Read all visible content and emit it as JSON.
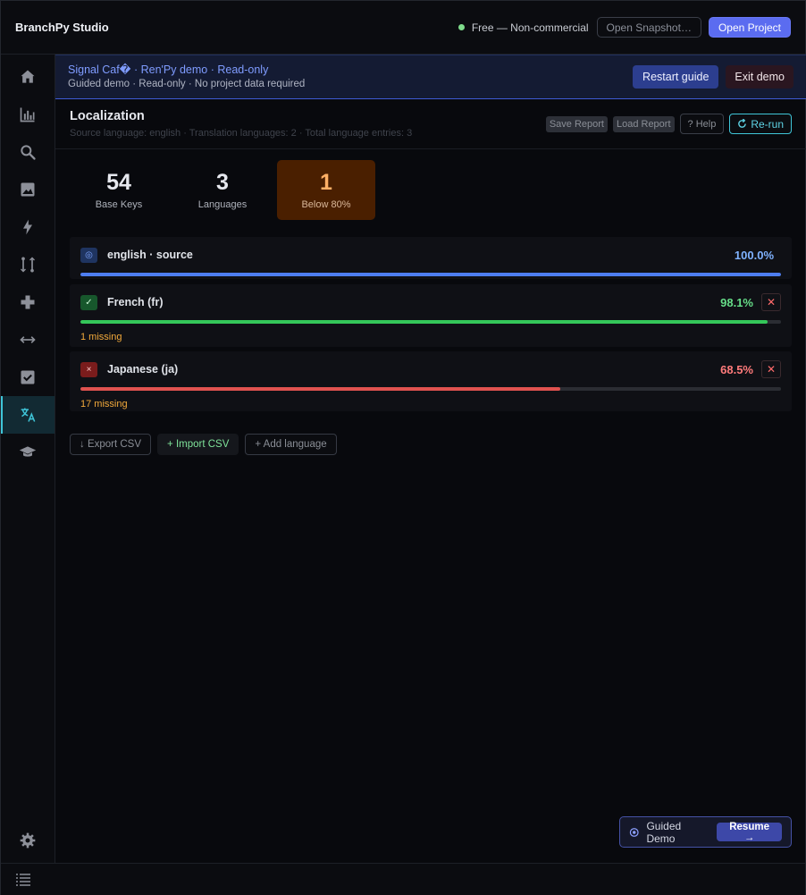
{
  "app": {
    "title": "BranchPy Studio",
    "license_status": "Free — Non-commercial",
    "open_snapshot_label": "Open Snapshot…",
    "open_project_label": "Open Project"
  },
  "banner": {
    "title": "Signal Caf� · Ren'Py demo · Read-only",
    "subtitle": "Guided demo · Read-only · No project data required",
    "restart_label": "Restart guide",
    "exit_label": "Exit demo"
  },
  "page": {
    "title": "Localization",
    "subtitle": "Source language: english · Translation languages: 2 · Total language entries: 3",
    "save_report_label": "Save Report",
    "load_report_label": "Load Report",
    "help_label": "? Help",
    "rerun_label": "Re-run"
  },
  "stats": [
    {
      "value": "54",
      "label": "Base Keys"
    },
    {
      "value": "3",
      "label": "Languages"
    },
    {
      "value": "1",
      "label": "Below 80%"
    }
  ],
  "languages": [
    {
      "name": "english · source",
      "percent_label": "100.0%",
      "percent": 100.0,
      "badge": "◎",
      "missing": "",
      "color": "#4d7df0"
    },
    {
      "name": "French (fr)",
      "percent_label": "98.1%",
      "percent": 98.1,
      "badge": "✓",
      "missing": "1 missing",
      "color": "#34c759"
    },
    {
      "name": "Japanese (ja)",
      "percent_label": "68.5%",
      "percent": 68.5,
      "badge": "×",
      "missing": "17 missing",
      "color": "#e0524f"
    }
  ],
  "actions": {
    "export_label": "↓ Export CSV",
    "import_label": "+ Import CSV",
    "add_label": "+ Add language"
  },
  "guided": {
    "label": "Guided Demo",
    "resume_label": "Resume →"
  },
  "icons": {
    "sidebar": [
      "home-icon",
      "chart-icon",
      "search-icon",
      "image-icon",
      "bolt-icon",
      "branch-icon",
      "plus-icon",
      "arrows-icon",
      "check-icon",
      "translate-icon",
      "graduation-icon"
    ],
    "settings": "gear-icon",
    "bottom": "list-icon"
  },
  "colors": {
    "accent": "#5b6cf0",
    "active_nav": "#3fc5d8",
    "warning": "#ffb066"
  }
}
